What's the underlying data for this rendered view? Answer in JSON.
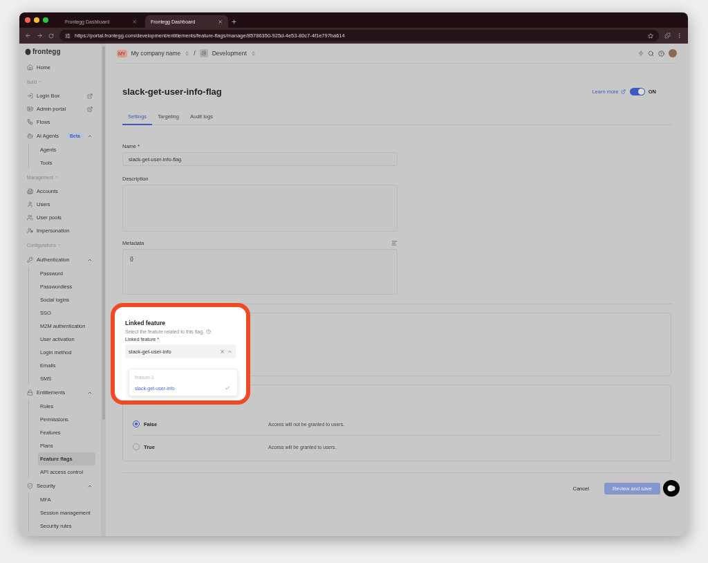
{
  "browser": {
    "tabs": [
      {
        "title": "Frontegg Dashboard",
        "selected": false
      },
      {
        "title": "Frontegg Dashboard",
        "selected": true
      }
    ],
    "url": "https://portal.frontegg.com/development/entitlements/feature-flags/manage/85786350-925d-4e53-80c7-4f1e797ba614"
  },
  "sidebar": {
    "logo": "frontegg",
    "items": [
      {
        "kind": "item",
        "label": "Home",
        "selected": false
      },
      {
        "kind": "heading",
        "label": "Build"
      },
      {
        "kind": "item",
        "label": "Login Box",
        "selected": false,
        "external": true
      },
      {
        "kind": "item",
        "label": "Admin portal",
        "selected": false,
        "external": true
      },
      {
        "kind": "item",
        "label": "Flows",
        "selected": false
      },
      {
        "kind": "parent",
        "label": "AI Agents",
        "badge": "Beta",
        "expanded": true,
        "children": [
          {
            "label": "Agents",
            "selected": false
          },
          {
            "label": "Tools",
            "selected": false
          }
        ]
      },
      {
        "kind": "heading",
        "label": "Management"
      },
      {
        "kind": "item",
        "label": "Accounts",
        "selected": false
      },
      {
        "kind": "item",
        "label": "Users",
        "selected": false
      },
      {
        "kind": "item",
        "label": "User pools",
        "selected": false
      },
      {
        "kind": "item",
        "label": "Impersonation",
        "selected": false
      },
      {
        "kind": "heading",
        "label": "Configurations"
      },
      {
        "kind": "parent",
        "label": "Authentication",
        "expanded": true,
        "children": [
          {
            "label": "Password",
            "selected": false
          },
          {
            "label": "Passwordless",
            "selected": false
          },
          {
            "label": "Social logins",
            "selected": false
          },
          {
            "label": "SSO",
            "selected": false
          },
          {
            "label": "M2M authentication",
            "selected": false
          },
          {
            "label": "User activation",
            "selected": false
          },
          {
            "label": "Login method",
            "selected": false
          },
          {
            "label": "Emails",
            "selected": false
          },
          {
            "label": "SMS",
            "selected": false
          }
        ]
      },
      {
        "kind": "parent",
        "label": "Entitlements",
        "expanded": true,
        "children": [
          {
            "label": "Roles",
            "selected": false
          },
          {
            "label": "Permissions",
            "selected": false
          },
          {
            "label": "Features",
            "selected": false
          },
          {
            "label": "Plans",
            "selected": false
          },
          {
            "label": "Feature flags",
            "selected": true
          },
          {
            "label": "API access control",
            "selected": false
          }
        ]
      },
      {
        "kind": "parent",
        "label": "Security",
        "expanded": true,
        "children": [
          {
            "label": "MFA",
            "selected": false
          },
          {
            "label": "Session management",
            "selected": false
          },
          {
            "label": "Security rules",
            "selected": false
          }
        ]
      }
    ]
  },
  "header": {
    "workspace_badge": "MY",
    "workspace": "My company name",
    "separator": "/",
    "environment": "Development"
  },
  "page": {
    "title": "slack-get-user-info-flag",
    "learn_more": "Learn more",
    "toggle": {
      "on": true,
      "label": "ON"
    },
    "tabs": [
      {
        "label": "Settings",
        "selected": true
      },
      {
        "label": "Targeting",
        "selected": false
      },
      {
        "label": "Audit logs",
        "selected": false
      }
    ],
    "name": {
      "label": "Name *",
      "value": "slack-get-user-info-flag"
    },
    "description": {
      "label": "Description"
    },
    "metadata": {
      "label": "Metadata",
      "value": "{}"
    }
  },
  "linked_feature": {
    "title": "Linked feature",
    "subtitle": "Select the feature related to this flag.",
    "field_label": "Linked feature *",
    "value": "slack-get-user-info",
    "options": [
      {
        "label": "feature-1",
        "selected": false,
        "disabled": true
      },
      {
        "label": "slack-get-user-info",
        "selected": true,
        "disabled": false
      }
    ]
  },
  "serve": {
    "options": [
      {
        "label": "False",
        "description": "Access will not be granted to users.",
        "selected": true
      },
      {
        "label": "True",
        "description": "Access will be granted to users.",
        "selected": false
      }
    ]
  },
  "actions": {
    "cancel": "Cancel",
    "submit": {
      "label": "Review and save",
      "disabled": true
    }
  }
}
